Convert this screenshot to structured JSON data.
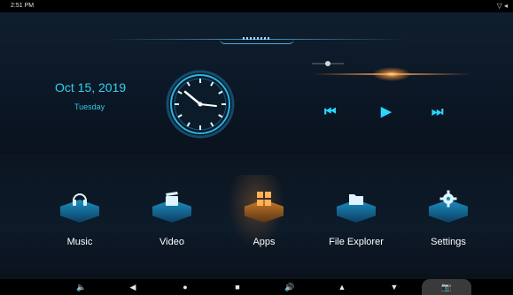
{
  "status_bar": {
    "time": "2:51 PM",
    "system_icons": "▽ ◂"
  },
  "top": {
    "date": "Oct 15, 2019",
    "weekday": "Tuesday",
    "media": {
      "prev": "⏮",
      "play": "▶",
      "next": "⏭"
    }
  },
  "apps": [
    {
      "label": "Music",
      "icon": "headphones-icon"
    },
    {
      "label": "Video",
      "icon": "video-clapper-icon"
    },
    {
      "label": "Apps",
      "icon": "apps-grid-icon"
    },
    {
      "label": "File Explorer",
      "icon": "folder-icon"
    },
    {
      "label": "Settings",
      "icon": "gear-icon"
    }
  ],
  "nav_bar": {
    "vol_down": "🔈",
    "back": "◀",
    "home": "●",
    "recents": "■",
    "vol_up": "🔊",
    "up": "▲",
    "down": "▼",
    "camera": "📷"
  },
  "colors": {
    "accent": "#2fd2f2",
    "apps_tile": "#c97a2a",
    "tile_blue": "#1d8fc2"
  }
}
